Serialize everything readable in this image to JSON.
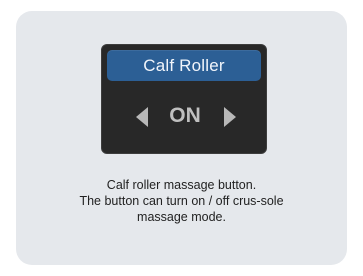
{
  "widget": {
    "title": "Calf Roller",
    "state": "ON",
    "left_arrow_icon": "left-triangle-icon",
    "right_arrow_icon": "right-triangle-icon",
    "colors": {
      "header_bg": "#2c5f95",
      "widget_bg": "#282828",
      "arrow": "#b8b8b8",
      "state_text": "#bfbfbf"
    }
  },
  "description": {
    "line1": "Calf roller massage button.",
    "line2": "The button can turn on / off crus-sole",
    "line3": "massage mode."
  },
  "card": {
    "background": "#e5e8ec"
  }
}
